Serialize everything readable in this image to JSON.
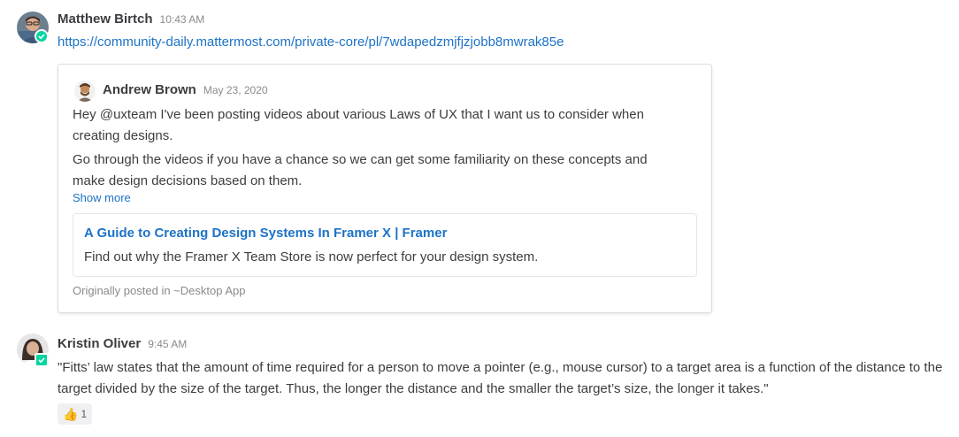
{
  "posts": [
    {
      "author": "Matthew Birtch",
      "time": "10:43 AM",
      "link": "https://community-daily.mattermost.com/private-core/pl/7wdapedzmjfjzjobb8mwrak85e",
      "permalink": {
        "author": "Andrew Brown",
        "date": "May 23, 2020",
        "paragraphs": [
          "Hey @uxteam I've been posting videos about various Laws of UX that I want us to consider when creating designs.",
          "Go through the videos if you have a chance so we can get some familiarity on these concepts and make design decisions based on them."
        ],
        "show_more": "Show more",
        "preview_title": "A Guide to Creating Design Systems In Framer X | Framer",
        "preview_description": "Find out why the Framer X Team Store is now perfect for your design system.",
        "origin": "Originally posted in ~Desktop App"
      }
    },
    {
      "author": "Kristin Oliver",
      "time": "9:45 AM",
      "message": "\"Fitts’ law states that the amount of time required for a person to move a pointer (e.g., mouse cursor) to a target area is a function of the distance to the target divided by the size of the target. Thus, the longer the distance and the smaller the target’s size, the longer it takes.\"",
      "reaction": {
        "icon": "thumbs-up-icon",
        "count": "1"
      }
    }
  ],
  "colors": {
    "link": "#1d72c7",
    "status_online": "#06d6a0",
    "muted": "#8a8a8c"
  }
}
